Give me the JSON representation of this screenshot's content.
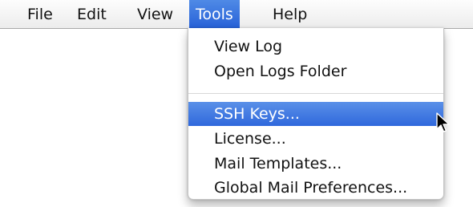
{
  "menubar": {
    "items": [
      {
        "label": "File",
        "active": false
      },
      {
        "label": "Edit",
        "active": false
      },
      {
        "label": "View",
        "active": false
      },
      {
        "label": "Tools",
        "active": true
      },
      {
        "label": "Help",
        "active": false
      }
    ]
  },
  "tools_menu": {
    "items": [
      {
        "label": "View Log"
      },
      {
        "label": "Open Logs Folder"
      },
      {
        "label": "SSH Keys...",
        "highlighted": true
      },
      {
        "label": "License..."
      },
      {
        "label": "Mail Templates..."
      },
      {
        "label": "Global Mail Preferences..."
      }
    ]
  },
  "colors": {
    "highlight": "#2f68dc",
    "menubar_bg": "#ececec",
    "text": "#111111"
  },
  "icons": {
    "cursor": "mouse-pointer-icon"
  }
}
